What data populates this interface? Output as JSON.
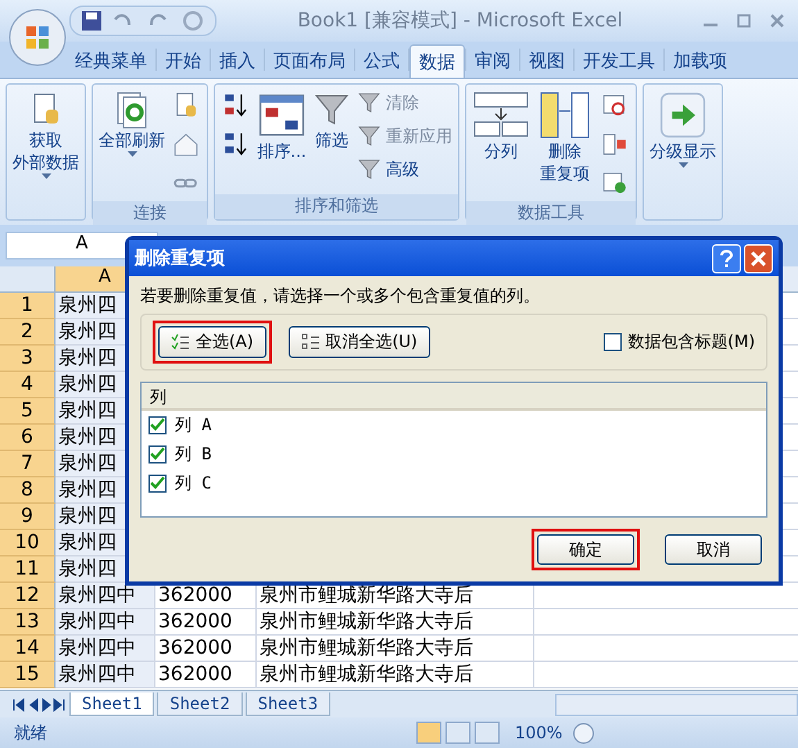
{
  "window": {
    "title": "Book1  [兼容模式] - Microsoft Excel"
  },
  "tabs": [
    {
      "label": "经典菜单",
      "selected": false
    },
    {
      "label": "开始",
      "selected": false
    },
    {
      "label": "插入",
      "selected": false
    },
    {
      "label": "页面布局",
      "selected": false
    },
    {
      "label": "公式",
      "selected": false
    },
    {
      "label": "数据",
      "selected": true
    },
    {
      "label": "审阅",
      "selected": false
    },
    {
      "label": "视图",
      "selected": false
    },
    {
      "label": "开发工具",
      "selected": false
    },
    {
      "label": "加载项",
      "selected": false
    }
  ],
  "ribbon": {
    "groups": [
      {
        "items": [
          {
            "kind": "large",
            "lines": [
              "获取",
              "外部数据"
            ],
            "dropdown": true
          }
        ]
      },
      {
        "label": "连接",
        "items": [
          {
            "kind": "large",
            "lines": [
              "全部刷新"
            ],
            "dropdown": true
          },
          {
            "kind": "stack"
          }
        ]
      },
      {
        "label": "排序和筛选",
        "items": [
          {
            "kind": "stack"
          },
          {
            "kind": "large",
            "lines": [
              "排序..."
            ],
            "dropdown": false
          },
          {
            "kind": "large",
            "lines": [
              "筛选"
            ],
            "dropdown": false
          },
          {
            "kind": "smalls",
            "rows": [
              {
                "label": "清除",
                "disabled": true
              },
              {
                "label": "重新应用",
                "disabled": true
              },
              {
                "label": "高级",
                "disabled": false
              }
            ]
          }
        ]
      },
      {
        "label": "数据工具",
        "items": [
          {
            "kind": "large",
            "lines": [
              "分列"
            ],
            "dropdown": false
          },
          {
            "kind": "large",
            "lines": [
              "删除",
              "重复项"
            ],
            "dropdown": false
          },
          {
            "kind": "stack"
          }
        ]
      },
      {
        "items": [
          {
            "kind": "large",
            "lines": [
              "分级显示"
            ],
            "dropdown": true
          }
        ]
      }
    ]
  },
  "name_box": "A",
  "column_headers": [
    "A"
  ],
  "rows": [
    {
      "header": "1",
      "cells": [
        "泉州四"
      ]
    },
    {
      "header": "2",
      "cells": [
        "泉州四"
      ]
    },
    {
      "header": "3",
      "cells": [
        "泉州四"
      ]
    },
    {
      "header": "4",
      "cells": [
        "泉州四"
      ]
    },
    {
      "header": "5",
      "cells": [
        "泉州四"
      ]
    },
    {
      "header": "6",
      "cells": [
        "泉州四"
      ]
    },
    {
      "header": "7",
      "cells": [
        "泉州四"
      ]
    },
    {
      "header": "8",
      "cells": [
        "泉州四"
      ]
    },
    {
      "header": "9",
      "cells": [
        "泉州四"
      ]
    },
    {
      "header": "10",
      "cells": [
        "泉州四"
      ]
    },
    {
      "header": "11",
      "cells": [
        "泉州四"
      ]
    },
    {
      "header": "12",
      "cells": [
        "泉州四中",
        "362000",
        "泉州市鲤城新华路大寺后"
      ]
    },
    {
      "header": "13",
      "cells": [
        "泉州四中",
        "362000",
        "泉州市鲤城新华路大寺后"
      ]
    },
    {
      "header": "14",
      "cells": [
        "泉州四中",
        "362000",
        "泉州市鲤城新华路大寺后"
      ]
    },
    {
      "header": "15",
      "cells": [
        "泉州四中",
        "362000",
        "泉州市鲤城新华路大寺后"
      ]
    }
  ],
  "sheet_tabs": [
    {
      "label": "Sheet1",
      "selected": true
    },
    {
      "label": "Sheet2",
      "selected": false
    },
    {
      "label": "Sheet3",
      "selected": false
    }
  ],
  "status_bar": {
    "status": "就绪",
    "zoom": "100%",
    "views": [
      {
        "selected": true
      },
      {
        "selected": false
      },
      {
        "selected": false
      }
    ]
  },
  "dialog": {
    "title": "删除重复项",
    "instruction": "若要删除重复值，请选择一个或多个包含重复值的列。",
    "select_all": {
      "label": "全选(A)",
      "highlighted": true
    },
    "unselect_all": {
      "label": "取消全选(U)",
      "highlighted": false
    },
    "header_checkbox": {
      "label": "数据包含标题(M)",
      "checked": false
    },
    "list_header": "列",
    "columns": [
      {
        "label": "列 A",
        "checked": true
      },
      {
        "label": "列 B",
        "checked": true
      },
      {
        "label": "列 C",
        "checked": true
      }
    ],
    "ok": {
      "label": "确定",
      "highlighted": true
    },
    "cancel": {
      "label": "取消",
      "highlighted": false
    }
  }
}
